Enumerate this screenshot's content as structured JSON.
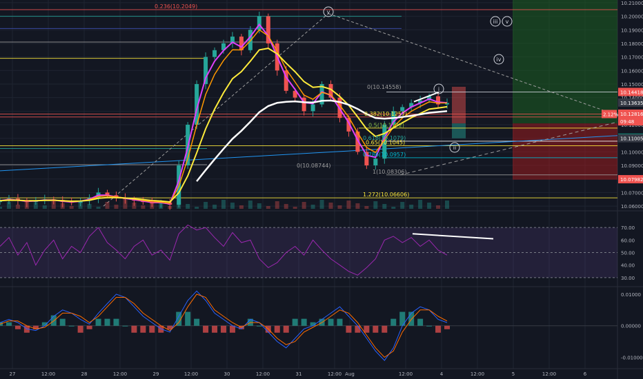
{
  "theme": {
    "background": "#131722",
    "grid": "#1f2431",
    "axis_text": "#b2b5be",
    "up": "#26a69a",
    "down": "#ef5350",
    "ema_fast": "#e040fb",
    "ema_mid": "#ff9800",
    "ema_slow": "#ffeb3b",
    "ma_long": "#ffffff",
    "rsi": "#9c27b0",
    "macd": "#2962ff",
    "signal": "#ff6d00",
    "hist_pos": "#26a69a",
    "hist_neg": "#ef5350"
  },
  "chart_data": [
    {
      "type": "candlestick",
      "panel": "price",
      "x_ticks": [
        "27",
        "12:00",
        "28",
        "12:00",
        "29",
        "12:00",
        "30",
        "12:00",
        "31",
        "12:00",
        "Aug",
        "12:00",
        "4",
        "12:00",
        "5",
        "12:00",
        "6"
      ],
      "y_ticks": [
        "10.21000",
        "10.20000",
        "10.19000",
        "10.18000",
        "10.17000",
        "10.16000",
        "10.15000",
        "10.14000",
        "10.13000",
        "10.12000",
        "10.11000",
        "10.10000",
        "10.09000",
        "10.08000",
        "10.07000",
        "10.06000"
      ],
      "ylim": [
        10.058,
        10.212
      ],
      "price_labels": [
        {
          "text": "10.14418",
          "value": 10.14418,
          "color": "#ef5350"
        },
        {
          "text": "10.13635",
          "value": 10.13635,
          "color": "#363a45"
        },
        {
          "text": "10.12816",
          "value": 10.12816,
          "color": "#ef5350"
        },
        {
          "text": "09:48",
          "value": 10.1225,
          "color": "#ef5350"
        },
        {
          "text": "10.11049",
          "value": 10.11049,
          "color": "#089981"
        },
        {
          "text": "10.11005",
          "value": 10.11005,
          "color": "#363a45"
        },
        {
          "text": "10.07982",
          "value": 10.07982,
          "color": "#ef5350"
        }
      ],
      "pct_badge": "2.12%",
      "wave_labels": [
        "v",
        "iii",
        "v",
        "iv",
        "i",
        "ii"
      ],
      "fib_labels": [
        "0.236(10.2049)",
        "0.382(10.1257)",
        "0.5(10.1172)",
        "0.618(10.1079)",
        "0.65(10.1045)",
        "0.786(10.0957)",
        "1(10.08306)",
        "0(10.08744)",
        "1.272(10.06606)",
        "0(10.14558)"
      ],
      "close_series": [
        10.064,
        10.0655,
        10.064,
        10.063,
        10.064,
        10.065,
        10.0645,
        10.063,
        10.0625,
        10.064,
        10.066,
        10.07,
        10.068,
        10.066,
        10.065,
        10.064,
        10.063,
        10.062,
        10.0625,
        10.061,
        10.09,
        10.12,
        10.15,
        10.17,
        10.175,
        10.18,
        10.185,
        10.175,
        10.19,
        10.2,
        10.18,
        10.16,
        10.145,
        10.14,
        10.13,
        10.135,
        10.15,
        10.14,
        10.125,
        10.115,
        10.1,
        10.09,
        10.095,
        10.12,
        10.13,
        10.133,
        10.136,
        10.138,
        10.141,
        10.135,
        10.136
      ]
    },
    {
      "type": "line",
      "panel": "rsi",
      "y_ticks": [
        "70.00",
        "60.00",
        "50.00",
        "40.00",
        "30.00"
      ],
      "ylim": [
        25,
        80
      ],
      "bands": [
        30,
        70
      ],
      "values": [
        55,
        62,
        48,
        58,
        40,
        52,
        60,
        45,
        55,
        50,
        63,
        70,
        58,
        52,
        45,
        55,
        60,
        48,
        52,
        44,
        65,
        72,
        68,
        70,
        62,
        55,
        66,
        58,
        60,
        45,
        38,
        42,
        50,
        55,
        48,
        60,
        52,
        45,
        40,
        35,
        32,
        38,
        45,
        60,
        63,
        58,
        62,
        55,
        60,
        52,
        48
      ]
    },
    {
      "type": "line",
      "panel": "macd",
      "y_ticks": [
        "0.01000",
        "0.00000",
        "-0.01000"
      ],
      "ylim": [
        -0.0125,
        0.0115
      ],
      "macd": [
        0.001,
        0.002,
        0.001,
        -0.001,
        -0.0015,
        0.0,
        0.003,
        0.005,
        0.004,
        0.002,
        0.0005,
        0.004,
        0.007,
        0.01,
        0.009,
        0.006,
        0.003,
        0.001,
        -0.001,
        -0.002,
        0.003,
        0.008,
        0.011,
        0.008,
        0.004,
        0.002,
        0.0,
        -0.001,
        0.002,
        0.001,
        -0.002,
        -0.005,
        -0.007,
        -0.004,
        -0.001,
        0.0,
        0.002,
        0.004,
        0.006,
        0.003,
        0.0,
        -0.004,
        -0.008,
        -0.011,
        -0.007,
        0.0,
        0.004,
        0.006,
        0.005,
        0.002,
        0.001
      ],
      "signal": [
        0.0005,
        0.0015,
        0.0015,
        0.0,
        -0.001,
        -0.0005,
        0.0015,
        0.004,
        0.004,
        0.003,
        0.001,
        0.003,
        0.006,
        0.009,
        0.009,
        0.007,
        0.004,
        0.002,
        0.0,
        -0.0015,
        0.001,
        0.006,
        0.01,
        0.009,
        0.005,
        0.003,
        0.001,
        -0.0005,
        0.001,
        0.001,
        -0.001,
        -0.004,
        -0.006,
        -0.005,
        -0.002,
        -0.0005,
        0.001,
        0.003,
        0.005,
        0.004,
        0.001,
        -0.003,
        -0.007,
        -0.01,
        -0.008,
        -0.002,
        0.002,
        0.005,
        0.005,
        0.003,
        0.0015
      ]
    }
  ]
}
